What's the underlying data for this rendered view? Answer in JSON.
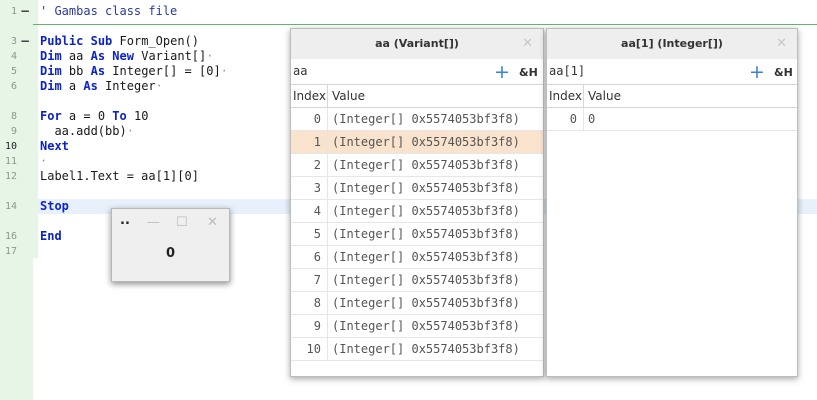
{
  "editor": {
    "line_numbers": [
      "1",
      "3",
      "4",
      "5",
      "6",
      "8",
      "9",
      "10",
      "11",
      "12",
      "14",
      "16",
      "17"
    ],
    "comment_line": "' Gambas class file",
    "lines": {
      "l3": [
        "Public",
        "Sub",
        "Form_Open()"
      ],
      "l4": [
        "Dim",
        "aa",
        "As",
        "New",
        "Variant[]",
        "·"
      ],
      "l5": [
        "Dim",
        "bb",
        "As",
        "Integer[] = [0]",
        "·"
      ],
      "l6": [
        "Dim",
        "a",
        "As",
        "Integer",
        "·"
      ],
      "l8": [
        "For",
        "a = 0",
        "To",
        "10"
      ],
      "l9": [
        "  aa.add(bb)",
        "·"
      ],
      "l10": [
        "Next"
      ],
      "l11": [
        "·"
      ],
      "l12": [
        "Label1.Text = aa[1][0]"
      ],
      "l14": [
        "Stop"
      ],
      "l16": [
        "End"
      ]
    }
  },
  "form_window": {
    "title": "..",
    "minimize_glyph": "—",
    "maximize_glyph": "☐",
    "close_glyph": "✕",
    "label_value": "0"
  },
  "panel_aa": {
    "title": "aa (Variant[])",
    "close_glyph": "✕",
    "expression": "aa",
    "add_glyph": "+",
    "hex_label": "&H",
    "col_index": "Index",
    "col_value": "Value",
    "rows": [
      {
        "index": "0",
        "value": "(Integer[] 0x5574053bf3f8)"
      },
      {
        "index": "1",
        "value": "(Integer[] 0x5574053bf3f8)"
      },
      {
        "index": "2",
        "value": "(Integer[] 0x5574053bf3f8)"
      },
      {
        "index": "3",
        "value": "(Integer[] 0x5574053bf3f8)"
      },
      {
        "index": "4",
        "value": "(Integer[] 0x5574053bf3f8)"
      },
      {
        "index": "5",
        "value": "(Integer[] 0x5574053bf3f8)"
      },
      {
        "index": "6",
        "value": "(Integer[] 0x5574053bf3f8)"
      },
      {
        "index": "7",
        "value": "(Integer[] 0x5574053bf3f8)"
      },
      {
        "index": "8",
        "value": "(Integer[] 0x5574053bf3f8)"
      },
      {
        "index": "9",
        "value": "(Integer[] 0x5574053bf3f8)"
      },
      {
        "index": "10",
        "value": "(Integer[] 0x5574053bf3f8)"
      }
    ],
    "selected_row": 1
  },
  "panel_aa1": {
    "title": "aa[1] (Integer[])",
    "close_glyph": "✕",
    "expression": "aa[1]",
    "add_glyph": "+",
    "hex_label": "&H",
    "col_index": "Index",
    "col_value": "Value",
    "rows": [
      {
        "index": "0",
        "value": "0"
      }
    ]
  },
  "colors": {
    "keyword": "#0b23c8",
    "gutter": "#e6f5e6",
    "selected_row": "#fae3cc",
    "accent": "#3b82d6"
  }
}
